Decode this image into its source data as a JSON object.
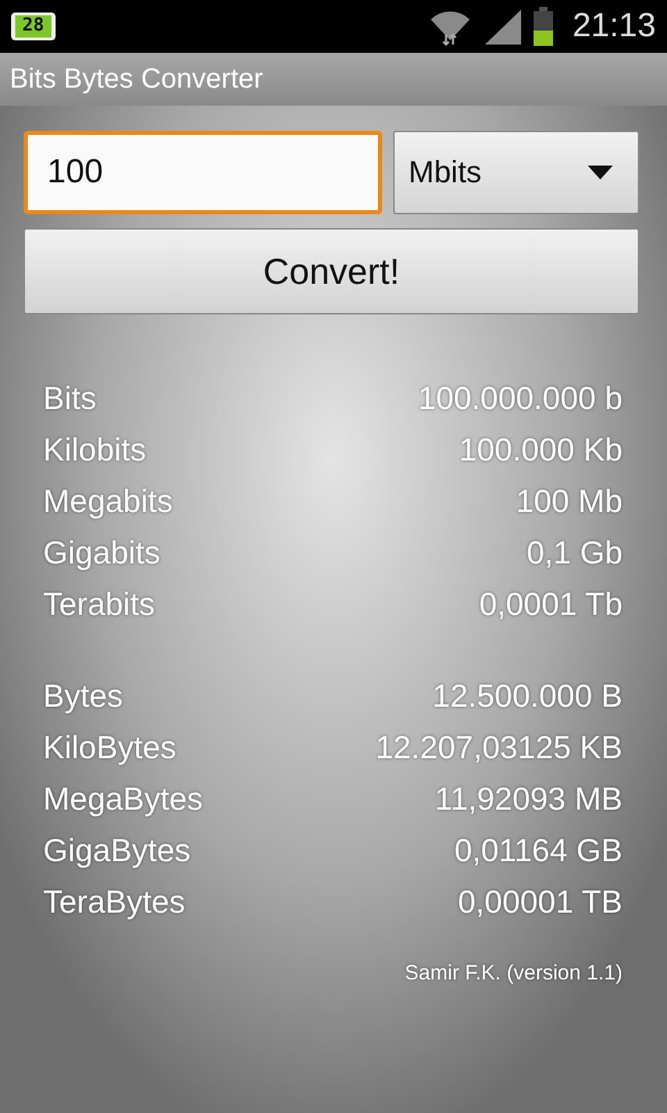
{
  "status_bar": {
    "battery_badge": "28",
    "time": "21:13"
  },
  "window": {
    "title": "Bits Bytes Converter"
  },
  "input": {
    "value": "100",
    "focused": true
  },
  "unit_dropdown": {
    "value": "Mbits"
  },
  "convert_button": {
    "label": "Convert!"
  },
  "groups": [
    {
      "rows": [
        {
          "label": "Bits",
          "value": "100.000.000 b"
        },
        {
          "label": "Kilobits",
          "value": "100.000 Kb"
        },
        {
          "label": "Megabits",
          "value": "100 Mb"
        },
        {
          "label": "Gigabits",
          "value": "0,1 Gb"
        },
        {
          "label": "Terabits",
          "value": "0,0001 Tb"
        }
      ]
    },
    {
      "rows": [
        {
          "label": "Bytes",
          "value": "12.500.000 B"
        },
        {
          "label": "KiloBytes",
          "value": "12.207,03125 KB"
        },
        {
          "label": "MegaBytes",
          "value": "11,92093 MB"
        },
        {
          "label": "GigaBytes",
          "value": "0,01164 GB"
        },
        {
          "label": "TeraBytes",
          "value": "0,00001 TB"
        }
      ]
    }
  ],
  "footer": "Samir F.K. (version 1.1)"
}
